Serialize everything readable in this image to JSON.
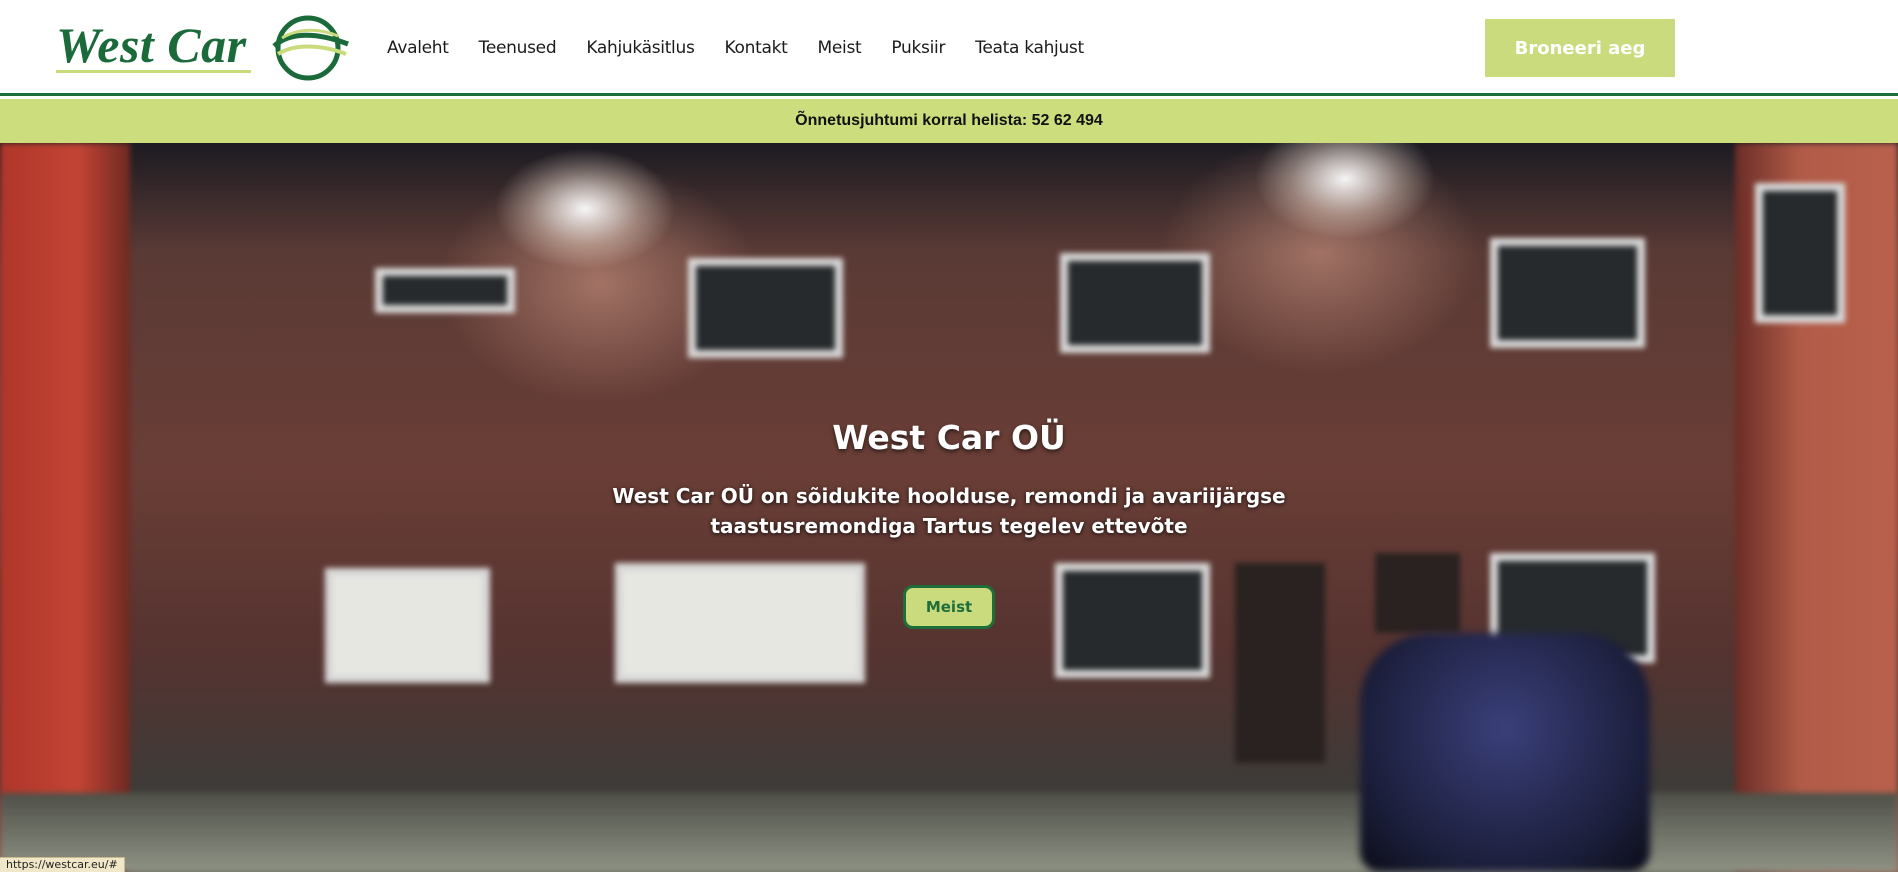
{
  "brand": {
    "name": "West Car",
    "accent": "#c9db7c",
    "primary": "#1f6e3a"
  },
  "nav": {
    "items": [
      "Avaleht",
      "Teenused",
      "Kahjukäsitlus",
      "Kontakt",
      "Meist",
      "Puksiir",
      "Teata kahjust"
    ]
  },
  "header": {
    "book_label": "Broneeri aeg"
  },
  "alert": {
    "text": "Õnnetusjuhtumi korral helista: 52 62 494"
  },
  "hero": {
    "title": "West Car OÜ",
    "subtitle": "West Car OÜ on sõidukite hoolduse, remondi ja avariijärgse taastusremondiga Tartus tegelev ettevõte",
    "button_label": "Meist"
  },
  "status_bar": {
    "url": "https://westcar.eu/#"
  }
}
